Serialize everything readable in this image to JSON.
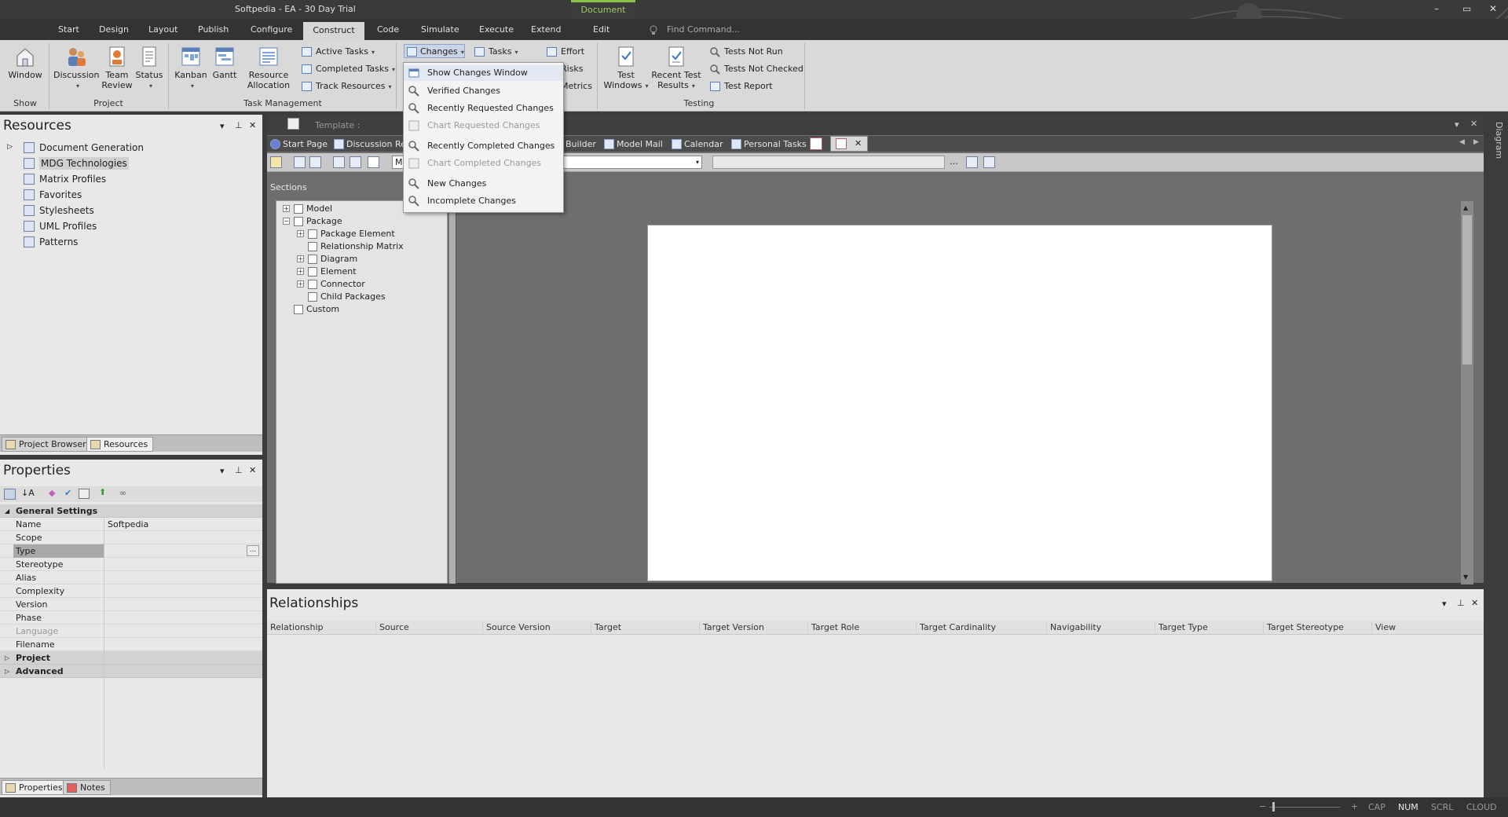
{
  "window": {
    "title": "Softpedia - EA - 30 Day Trial",
    "context_tab": "Document",
    "controls": [
      "–",
      "▭",
      "✕"
    ]
  },
  "ribbon_tabs": [
    "Start",
    "Design",
    "Layout",
    "Publish",
    "Configure",
    "Construct",
    "Code",
    "Simulate",
    "Execute",
    "Extend",
    "Edit"
  ],
  "active_tab": "Construct",
  "find_command": "Find Command...",
  "ribbon": {
    "show": {
      "window": "Window",
      "label": "Show"
    },
    "project": {
      "discussion": "Discussion",
      "team_review_1": "Team",
      "team_review_2": "Review",
      "status": "Status",
      "label": "Project"
    },
    "task_management": {
      "kanban": "Kanban",
      "gantt": "Gantt",
      "resource_allocation_1": "Resource",
      "resource_allocation_2": "Allocation",
      "active_tasks": "Active Tasks",
      "completed_tasks": "Completed Tasks",
      "track_resources": "Track Resources",
      "label": "Task Management"
    },
    "changes": "Changes",
    "tasks": "Tasks",
    "effort": "Effort",
    "risks": "Risks",
    "metrics": "Metrics",
    "testing": {
      "test_windows_1": "Test",
      "test_windows_2": "Windows",
      "recent_results_1": "Recent Test",
      "recent_results_2": "Results",
      "tests_not_run": "Tests Not Run",
      "tests_not_checked": "Tests Not Checked",
      "test_report": "Test Report",
      "label": "Testing"
    }
  },
  "changes_menu": [
    {
      "label": "Show Changes Window",
      "enabled": true
    },
    {
      "label": "Verified Changes",
      "enabled": true
    },
    {
      "label": "Recently Requested Changes",
      "enabled": true
    },
    {
      "label": "Chart Requested Changes",
      "enabled": false
    },
    {
      "label": "Recently Completed Changes",
      "enabled": true
    },
    {
      "label": "Chart Completed Changes",
      "enabled": false
    },
    {
      "label": "New Changes",
      "enabled": true
    },
    {
      "label": "Incomplete Changes",
      "enabled": true
    }
  ],
  "resources": {
    "title": "Resources",
    "items": [
      "Document Generation",
      "MDG Technologies",
      "Matrix Profiles",
      "Favorites",
      "Stylesheets",
      "UML Profiles",
      "Patterns"
    ],
    "tabs": [
      "Project Browser",
      "Resources"
    ]
  },
  "properties": {
    "title": "Properties",
    "section_general": "General Settings",
    "rows": [
      {
        "key": "Name",
        "value": "Softpedia"
      },
      {
        "key": "Scope",
        "value": ""
      },
      {
        "key": "Type",
        "value": ""
      },
      {
        "key": "Stereotype",
        "value": ""
      },
      {
        "key": "Alias",
        "value": ""
      },
      {
        "key": "Complexity",
        "value": ""
      },
      {
        "key": "Version",
        "value": ""
      },
      {
        "key": "Phase",
        "value": ""
      },
      {
        "key": "Language",
        "value": ""
      },
      {
        "key": "Filename",
        "value": ""
      }
    ],
    "section_project": "Project",
    "section_advanced": "Advanced",
    "tabs": [
      "Properties",
      "Notes"
    ],
    "ellipsis": "..."
  },
  "document": {
    "template_label": "Template :",
    "tabs": [
      "Start Page",
      "Discussion Re",
      "Builder",
      "Model Mail",
      "Calendar",
      "Personal Tasks"
    ],
    "combo_value": "M",
    "sections_label": "Sections",
    "sections": [
      {
        "label": "Model",
        "level": 0,
        "expander": "+"
      },
      {
        "label": "Package",
        "level": 0,
        "expander": "−"
      },
      {
        "label": "Package Element",
        "level": 1,
        "expander": "+"
      },
      {
        "label": "Relationship Matrix",
        "level": 1,
        "expander": ""
      },
      {
        "label": "Diagram",
        "level": 1,
        "expander": "+"
      },
      {
        "label": "Element",
        "level": 1,
        "expander": "+"
      },
      {
        "label": "Connector",
        "level": 1,
        "expander": "+"
      },
      {
        "label": "Child Packages",
        "level": 1,
        "expander": ""
      },
      {
        "label": "Custom",
        "level": 0,
        "expander": ""
      }
    ]
  },
  "relationships": {
    "title": "Relationships",
    "columns": [
      "Relationship",
      "Source",
      "Source Version",
      "Target",
      "Target Version",
      "Target Role",
      "Target Cardinality",
      "Navigability",
      "Target Type",
      "Target Stereotype",
      "View"
    ]
  },
  "side_panel": "Diagram",
  "status": {
    "minus": "−",
    "plus": "+",
    "cap": "CAP",
    "num": "NUM",
    "scrl": "SCRL",
    "cloud": "CLOUD"
  }
}
